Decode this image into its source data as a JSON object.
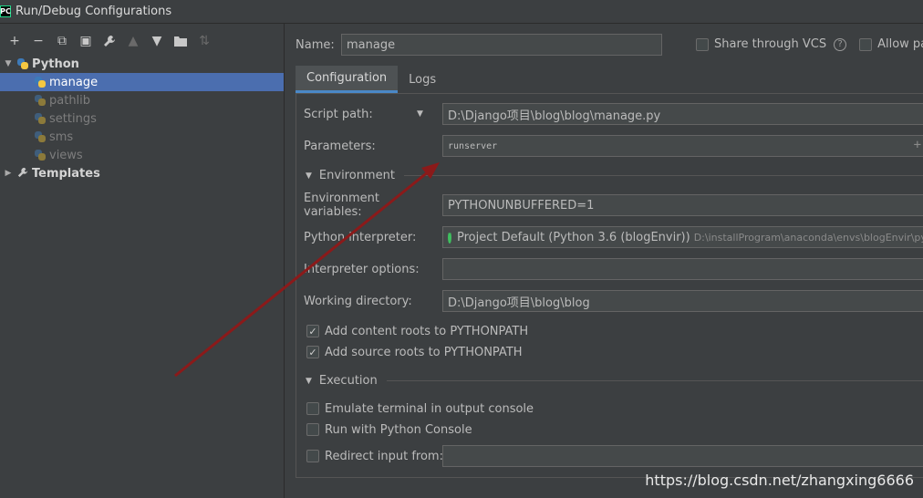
{
  "window": {
    "title": "Run/Debug Configurations",
    "app_icon": "pycharm-icon"
  },
  "toolbar": {
    "buttons": [
      "add-icon",
      "remove-icon",
      "copy-icon",
      "save-icon",
      "wrench-icon",
      "move-up-icon",
      "move-down-icon",
      "folder-add-icon",
      "sort-icon"
    ],
    "glyphs": {
      "add": "+",
      "remove": "−",
      "copy": "⧉",
      "save": "▣",
      "wrench": "🔧",
      "up": "▲",
      "down": "▼",
      "folder": "📁",
      "sort": "⇅"
    }
  },
  "tree": {
    "root": {
      "label": "Python",
      "arrow": "▼"
    },
    "items": [
      {
        "label": "manage",
        "selected": true
      },
      {
        "label": "pathlib"
      },
      {
        "label": "settings"
      },
      {
        "label": "sms"
      },
      {
        "label": "views"
      }
    ],
    "templates": {
      "label": "Templates",
      "arrow": "▶"
    }
  },
  "header": {
    "name_label": "Name:",
    "name_value": "manage",
    "share_vcs": "Share through VCS",
    "help": "?",
    "allow_parallel": "Allow para"
  },
  "tabs": [
    {
      "label": "Configuration",
      "active": true
    },
    {
      "label": "Logs"
    }
  ],
  "config": {
    "script_path_label": "Script path:",
    "script_path_value": "D:\\Django项目\\blog\\blog\\manage.py",
    "parameters_label": "Parameters:",
    "parameters_value": "runserver",
    "environment_section": "Environment",
    "env_vars_label": "Environment variables:",
    "env_vars_value": "PYTHONUNBUFFERED=1",
    "interpreter_label": "Python interpreter:",
    "interpreter_value": "Project Default (Python 3.6 (blogEnvir))",
    "interpreter_path": "D:\\installProgram\\anaconda\\envs\\blogEnvir\\pytho",
    "interpreter_options_label": "Interpreter options:",
    "interpreter_options_value": "",
    "working_dir_label": "Working directory:",
    "working_dir_value": "D:\\Django项目\\blog\\blog",
    "add_content_roots": "Add content roots to PYTHONPATH",
    "add_source_roots": "Add source roots to PYTHONPATH",
    "execution_section": "Execution",
    "emulate_terminal": "Emulate terminal in output console",
    "run_console": "Run with Python Console",
    "redirect_input": "Redirect input from:",
    "redirect_input_value": ""
  },
  "watermark": "https://blog.csdn.net/zhangxing6666",
  "colors": {
    "background": "#3c3f41",
    "selection": "#4b6eaf",
    "accent": "#4a88c7",
    "arrow": "#8b1a1a"
  }
}
